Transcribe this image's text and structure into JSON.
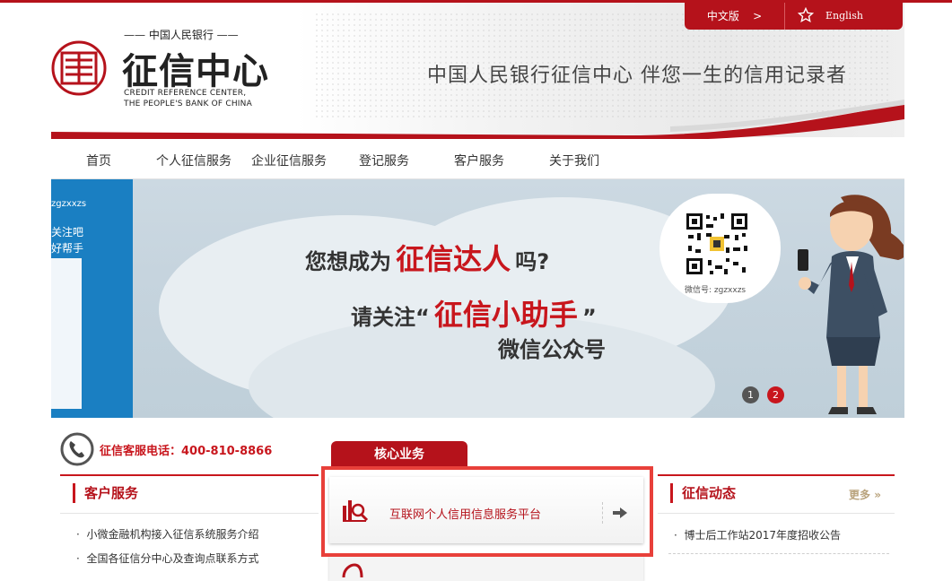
{
  "header": {
    "lang_cn": "中文版",
    "lang_cn_arrow": ">",
    "lang_en": "English",
    "logo_top": "—— 中国人民银行 ——",
    "logo_title": "征信中心",
    "logo_en_line1": "CREDIT REFERENCE CENTER,",
    "logo_en_line2": "THE PEOPLE'S BANK OF CHINA",
    "slogan": "中国人民银行征信中心   伴您一生的信用记录者",
    "colors": {
      "brand": "#b5121b",
      "accent": "#c8161d"
    }
  },
  "nav": {
    "items": [
      "首页",
      "个人征信服务",
      "企业征信服务",
      "登记服务",
      "客户服务",
      "关于我们"
    ]
  },
  "banner": {
    "left_id": "zgzxxzs",
    "left_line1": "关注吧",
    "left_line2": "好帮手",
    "line1_a": "您想成为",
    "line1_red": "征信达人",
    "line1_b": "吗?",
    "line2_a": "请关注“",
    "line2_red": "征信小助手",
    "line2_b": "”",
    "line3": "微信公众号",
    "qr_label": "微信号: zgzxxzs",
    "slide_1": "1",
    "slide_2": "2",
    "active_slide": 2
  },
  "hotline": {
    "text": "征信客服电话：400-810-8866"
  },
  "customer_service": {
    "title": "客户服务",
    "items": [
      "小微金融机构接入征信系统服务介绍",
      "全国各征信分中心及查询点联系方式"
    ]
  },
  "core_business": {
    "tab": "核心业务",
    "item1": "互联网个人信用信息服务平台",
    "icons": [
      "chart-search-icon",
      "arrow-right-icon"
    ]
  },
  "news": {
    "title": "征信动态",
    "more": "更多",
    "items": [
      "博士后工作站2017年度招收公告"
    ]
  }
}
